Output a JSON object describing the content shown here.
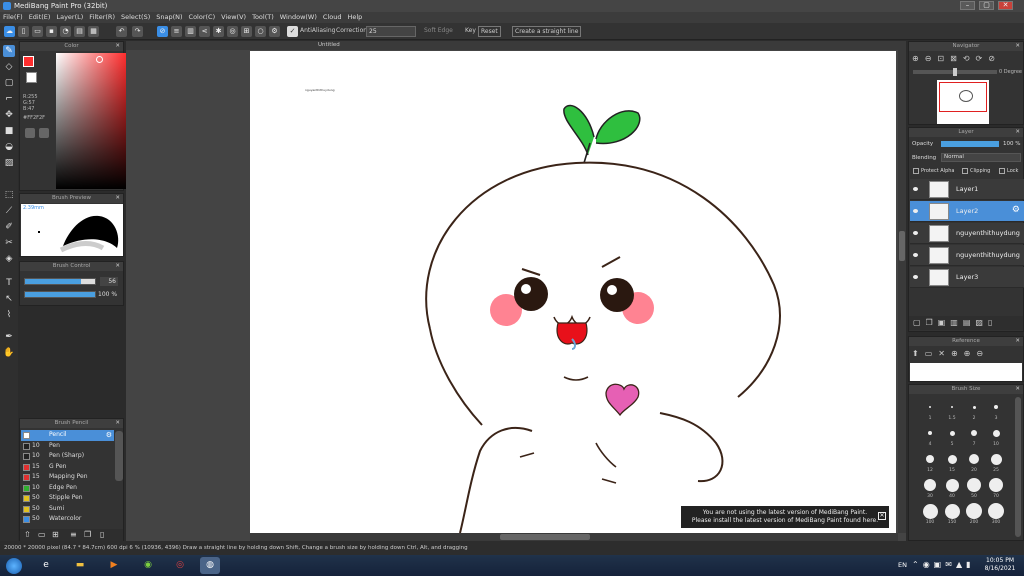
{
  "window": {
    "title": "MediBang Paint Pro (32bit)",
    "min": "–",
    "max": "▢",
    "close": "✕"
  },
  "menu": [
    "File(F)",
    "Edit(E)",
    "Layer(L)",
    "Filter(R)",
    "Select(S)",
    "Snap(N)",
    "Color(C)",
    "View(V)",
    "Tool(T)",
    "Window(W)",
    "Cloud",
    "Help"
  ],
  "toolbar": {
    "antialiasing": "AntiAliasing",
    "correction_label": "Correction",
    "correction_value": "25",
    "soft_edge": "Soft Edge",
    "key": "Key",
    "reset": "Reset",
    "straight": "Create a straight line"
  },
  "document": {
    "tab": "Untitled",
    "small_text": "nguyenthithuydung"
  },
  "color_panel": {
    "title": "Color",
    "r": "R:255",
    "g": "G:57",
    "b": "B:47",
    "hex": "#FF2F2F",
    "accent": "#FF2F2F"
  },
  "brush_preview": {
    "title": "Brush Preview",
    "size": "2.39mm"
  },
  "brush_control": {
    "title": "Brush Control",
    "size_value": "56",
    "opacity_value": "100 %",
    "size_fraction": 0.8,
    "opacity_fraction": 1.0
  },
  "brush_list": {
    "title": "Brush Pencil",
    "items": [
      {
        "size": "",
        "name": "Pencil",
        "color": "#ffffff"
      },
      {
        "size": "10",
        "name": "Pen",
        "color": "#222222"
      },
      {
        "size": "10",
        "name": "Pen (Sharp)",
        "color": "#222222"
      },
      {
        "size": "15",
        "name": "G Pen",
        "color": "#e03030"
      },
      {
        "size": "15",
        "name": "Mapping Pen",
        "color": "#e03030"
      },
      {
        "size": "10",
        "name": "Edge Pen",
        "color": "#30b030"
      },
      {
        "size": "50",
        "name": "Stipple Pen",
        "color": "#e0c020"
      },
      {
        "size": "50",
        "name": "Sumi",
        "color": "#e0c020"
      },
      {
        "size": "50",
        "name": "Watercolor",
        "color": "#3a8ee6"
      }
    ]
  },
  "navigator": {
    "title": "Navigator",
    "angle": "0 Degree"
  },
  "layers": {
    "title": "Layer",
    "opacity_label": "Opacity",
    "opacity_value": "100 %",
    "blending_label": "Blending",
    "blending_value": "Normal",
    "protect_alpha": "Protect Alpha",
    "clipping": "Clipping",
    "lock": "Lock",
    "items": [
      {
        "name": "Layer1",
        "selected": false
      },
      {
        "name": "Layer2",
        "selected": true
      },
      {
        "name": "nguyenthithuydung",
        "selected": false
      },
      {
        "name": "nguyenthithuydung",
        "selected": false
      },
      {
        "name": "Layer3",
        "selected": false
      }
    ]
  },
  "reference": {
    "title": "Reference"
  },
  "brush_size": {
    "title": "Brush Size",
    "labels": [
      "1",
      "1.5",
      "2",
      "3",
      "4",
      "5",
      "7",
      "10",
      "12",
      "15",
      "20",
      "25",
      "30",
      "40",
      "50",
      "70",
      "100",
      "150",
      "200",
      "300"
    ]
  },
  "toast": {
    "line1": "You are not using the latest version of MediBang Paint.",
    "line2": "Please install the latest version of MediBang Paint found here."
  },
  "status": "20000 * 20000 pixel (84.7 * 84.7cm) 600 dpi 6 % (10936, 4396) Draw a straight line by holding down Shift, Change a brush size by holding down Ctrl, Alt, and dragging",
  "taskbar": {
    "lang": "EN",
    "time": "10:05 PM",
    "date": "8/16/2021"
  }
}
